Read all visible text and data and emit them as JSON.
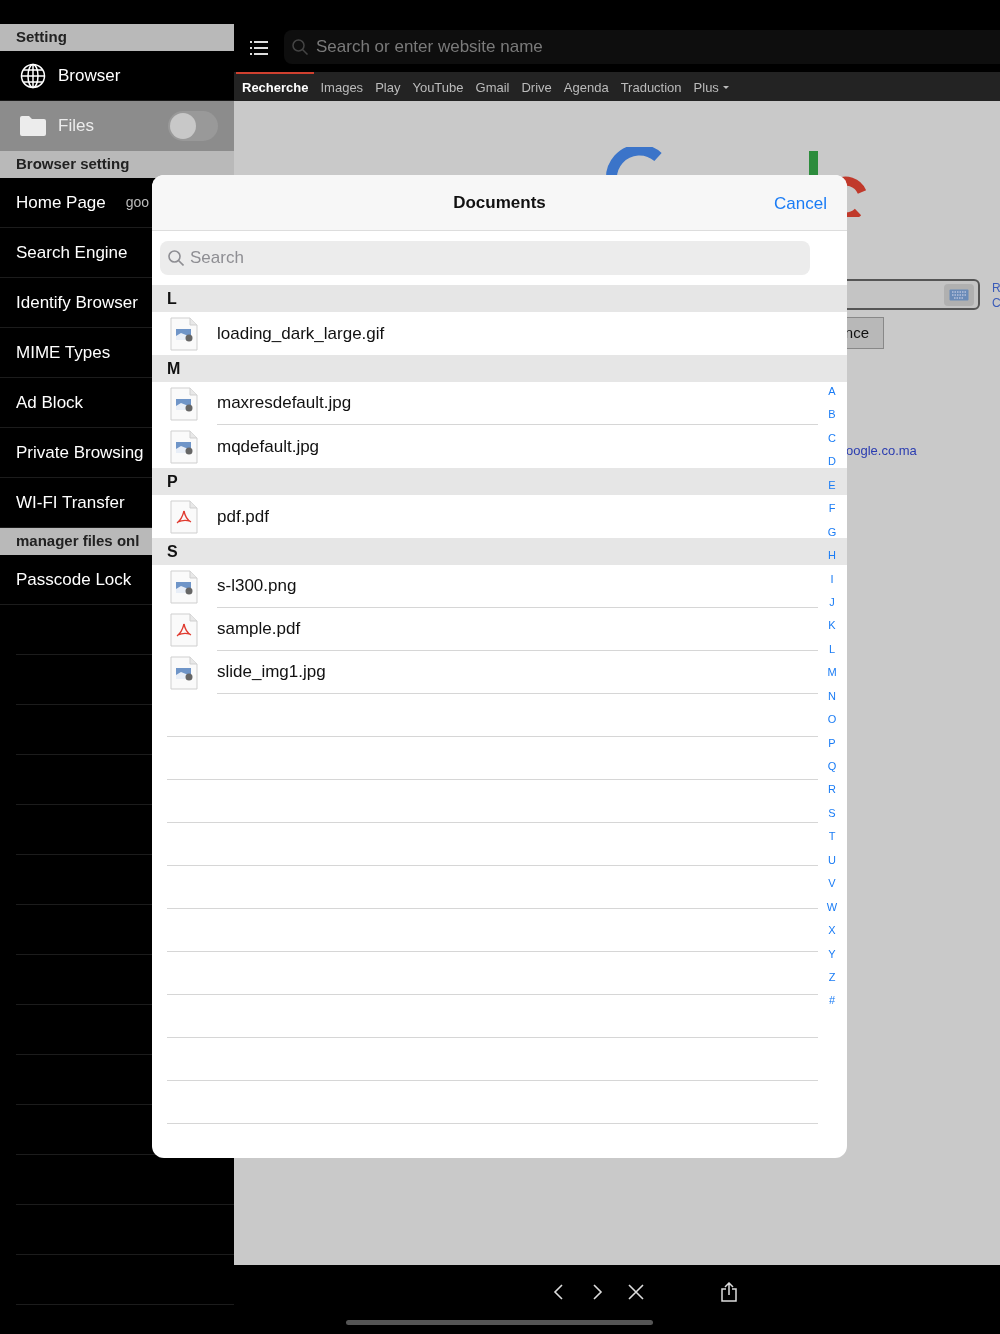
{
  "sidebar": {
    "sections": [
      {
        "title": "Setting",
        "items": [
          {
            "kind": "nav",
            "label": "Browser",
            "disabled": false
          },
          {
            "kind": "toggle",
            "label": "Files",
            "disabled": true,
            "on": false
          }
        ]
      },
      {
        "title": "Browser setting",
        "items": [
          {
            "kind": "setting",
            "label": "Home Page",
            "value": "goo"
          },
          {
            "kind": "setting",
            "label": "Search Engine"
          },
          {
            "kind": "setting",
            "label": "Identify Browser"
          },
          {
            "kind": "setting",
            "label": "MIME Types"
          },
          {
            "kind": "setting",
            "label": "Ad Block"
          },
          {
            "kind": "setting",
            "label": "Private Browsing"
          },
          {
            "kind": "setting",
            "label": "WI-FI Transfer"
          }
        ]
      },
      {
        "title": "manager files onl",
        "items": [
          {
            "kind": "setting",
            "label": "Passcode Lock"
          }
        ]
      }
    ]
  },
  "address_bar": {
    "placeholder": "Search or enter website name"
  },
  "nav_tabs": [
    {
      "label": "Recherche",
      "selected": true,
      "kind": "link"
    },
    {
      "label": "Images",
      "selected": false,
      "kind": "link"
    },
    {
      "label": "Play",
      "selected": false,
      "kind": "link"
    },
    {
      "label": "YouTube",
      "selected": false,
      "kind": "link"
    },
    {
      "label": "Gmail",
      "selected": false,
      "kind": "link"
    },
    {
      "label": "Drive",
      "selected": false,
      "kind": "link"
    },
    {
      "label": "Agenda",
      "selected": false,
      "kind": "link"
    },
    {
      "label": "Traduction",
      "selected": false,
      "kind": "link"
    },
    {
      "label": "Plus",
      "selected": false,
      "kind": "menu"
    }
  ],
  "page": {
    "search_button": "nce",
    "domain_link": "oogle.co.ma",
    "side_links": [
      "R",
      "C"
    ]
  },
  "dialog": {
    "title": "Documents",
    "cancel": "Cancel",
    "search": {
      "placeholder": "Search"
    },
    "sections": [
      {
        "letter": "L",
        "files": [
          {
            "name": "loading_dark_large.gif",
            "kind": "image"
          }
        ]
      },
      {
        "letter": "M",
        "files": [
          {
            "name": "maxresdefault.jpg",
            "kind": "image"
          },
          {
            "name": "mqdefault.jpg",
            "kind": "image"
          }
        ]
      },
      {
        "letter": "P",
        "files": [
          {
            "name": "pdf.pdf",
            "kind": "pdf"
          }
        ]
      },
      {
        "letter": "S",
        "files": [
          {
            "name": "s-l300.png",
            "kind": "image"
          },
          {
            "name": "sample.pdf",
            "kind": "pdf"
          },
          {
            "name": "slide_img1.jpg",
            "kind": "image"
          }
        ]
      }
    ],
    "index": [
      "A",
      "B",
      "C",
      "D",
      "E",
      "F",
      "G",
      "H",
      "I",
      "J",
      "K",
      "L",
      "M",
      "N",
      "O",
      "P",
      "Q",
      "R",
      "S",
      "T",
      "U",
      "V",
      "W",
      "X",
      "Y",
      "Z",
      "#"
    ]
  }
}
